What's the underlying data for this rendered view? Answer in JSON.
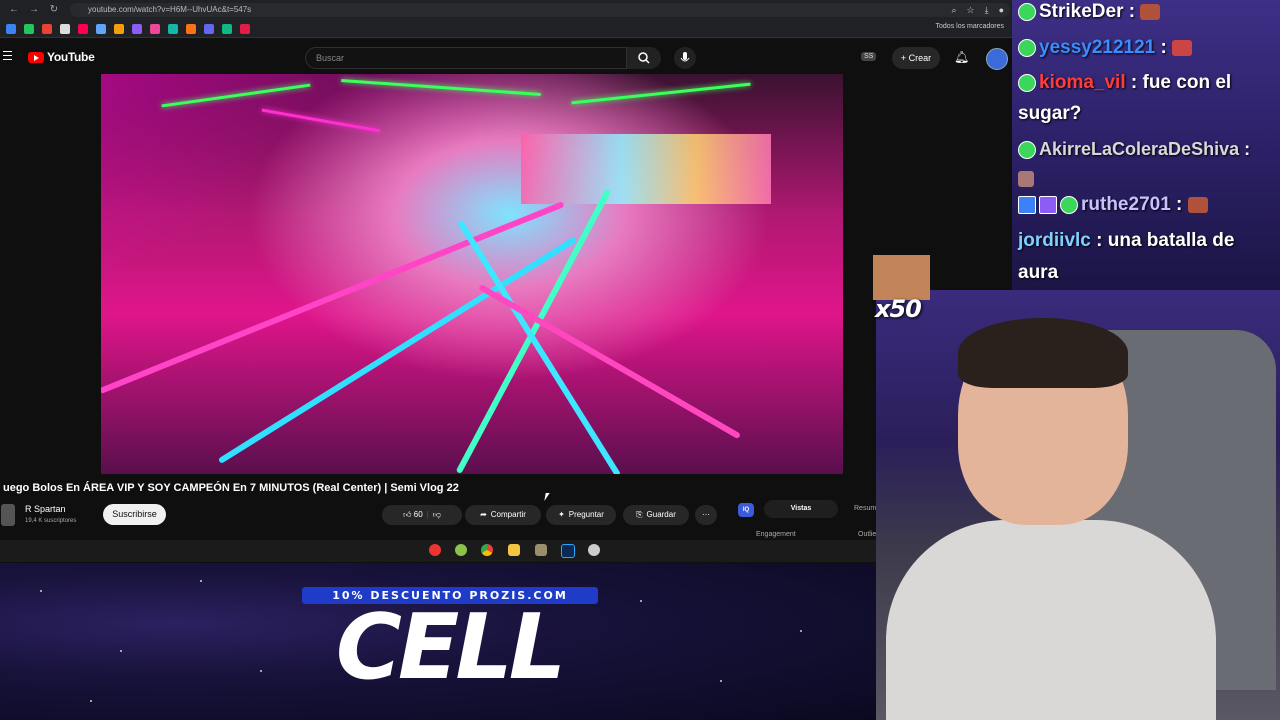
{
  "browser": {
    "url": "youtube.com/watch?v=H6M--UhvUAc&t=547s",
    "bookmarks_folder": "Todos los marcadores"
  },
  "youtube": {
    "logo_text": "YouTube",
    "search_placeholder": "Buscar",
    "ss_badge": "SS",
    "create_label": "Crear",
    "video_title": "uego Bolos En ÁREA VIP Y SOY CAMPEÓN En 7 MINUTOS (Real Center) | Semi Vlog 22",
    "channel_name": "R Spartan",
    "channel_subs": "19,4 K suscriptores",
    "subscribe_label": "Suscribirse",
    "like_count": "60",
    "share_label": "Compartir",
    "ask_label": "Preguntar",
    "save_label": "Guardar",
    "more_label": "···",
    "ext_iq": "IQ",
    "ext_tab_active": "Vistas",
    "ext_tab_other": "Resum",
    "ext_engagement": "Engagement",
    "ext_outlier": "Outlie"
  },
  "promo": {
    "discount": "10% DESCUENTO PROZIS.COM",
    "brand": "CELL"
  },
  "chat": {
    "messages": [
      {
        "user": "StrikeDer",
        "text": " :",
        "color": "#ffffff"
      },
      {
        "user": "yessy212121",
        "text": " :",
        "color": "#3a8dff"
      },
      {
        "user": "kioma_vil",
        "text": " : fue con el",
        "color": "#ff3b3b"
      },
      {
        "user": "",
        "text": "sugar?",
        "color": "#ffffff"
      },
      {
        "user": "AkirreLaColeraDeShiva",
        "text": " :",
        "color": "#d8d8d8"
      },
      {
        "user": "ruthe2701",
        "text": " :",
        "color": "#c9c1ff"
      },
      {
        "user": "jordiivlc",
        "text": " : una batalla de",
        "color": "#7fd0ff"
      },
      {
        "user": "",
        "text": "aura",
        "color": "#ffffff"
      }
    ]
  },
  "overlay": {
    "multiplier": "x50"
  }
}
